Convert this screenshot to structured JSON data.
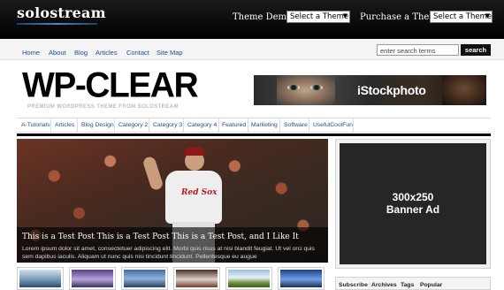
{
  "topbar": {
    "brand": "solostream",
    "theme_demo_label": "Theme Demo:",
    "theme_demo_value": "Select a Theme",
    "purchase_label": "Purchase a Theme:",
    "purchase_value": "Select a Theme"
  },
  "nav": {
    "items": [
      "Home",
      "About",
      "Blog",
      "Articles",
      "Contact",
      "Site Map"
    ],
    "search_placeholder": "enter search terms",
    "search_button": "search"
  },
  "header": {
    "logo": "WP-CLEAR",
    "tagline": "PREMIUM WORDPRESS THEME FROM SOLOSTREAM",
    "ad_brand": "iStockphoto"
  },
  "categories": [
    "A-Tutorials",
    "Articles",
    "Blog Design",
    "Category 2",
    "Category 3",
    "Category 4",
    "Featured",
    "Marketing",
    "Software",
    "UsefulCoolFun"
  ],
  "featured": {
    "title": "This is a Test Post This is a Test Post This is a Test Post, and I Like It",
    "excerpt": "Lorem ipsum dolor sit amet, consectetuer adipiscing elit. Morbi quis risus at nisi blandit feugiat. Ut vel orci quis sem dapibus iaculis. Aliquam ut nunc quis nisi tincidunt tincidunt. Pellentesque eu augue",
    "jersey_text": "Red Sox"
  },
  "sidebar": {
    "ad_line1": "300x250",
    "ad_line2": "Banner Ad",
    "tabs": [
      "Subscribe",
      "Archives",
      "Tags",
      "Popular"
    ]
  },
  "colors": {
    "link": "#1f4d91",
    "topbar": "#000000",
    "accent": "#4d87c4"
  }
}
